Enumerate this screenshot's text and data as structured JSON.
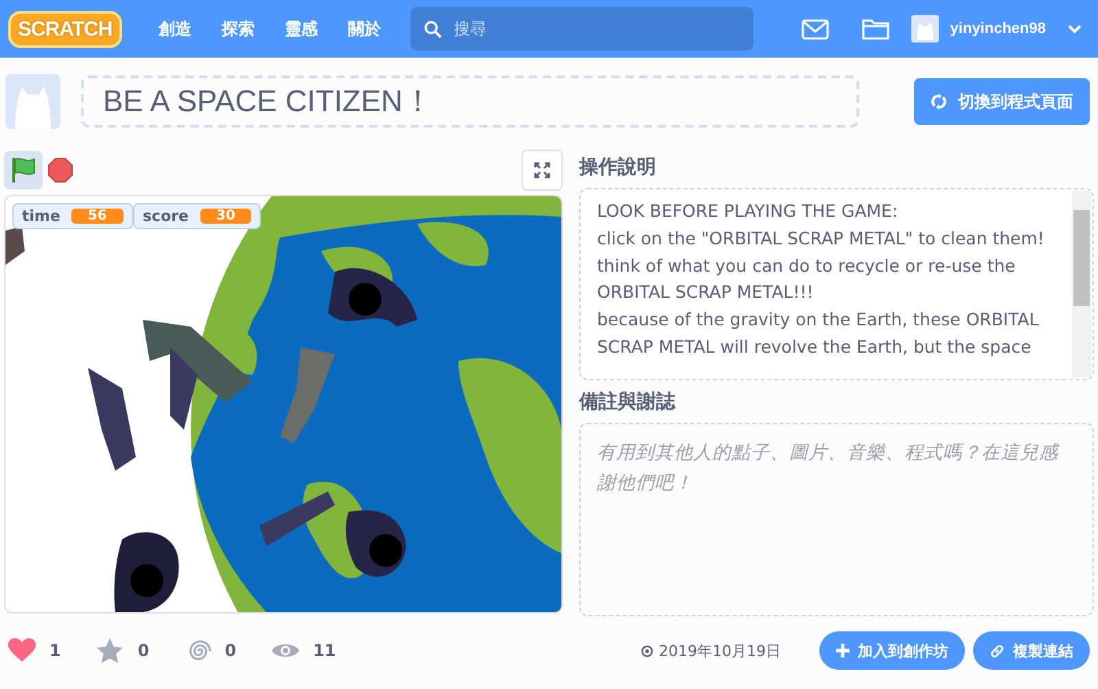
{
  "navbar": {
    "logo": "SCRATCH",
    "links": [
      "創造",
      "探索",
      "靈感",
      "關於"
    ],
    "search": {
      "placeholder": "搜尋"
    },
    "username": "yinyinchen98"
  },
  "project": {
    "title": "BE A SPACE CITIZEN！",
    "see_inside_button": "切換到程式頁面"
  },
  "stage": {
    "monitors": [
      {
        "label": "time",
        "value": "56"
      },
      {
        "label": "score",
        "value": "30"
      }
    ]
  },
  "instructions": {
    "heading": "操作說明",
    "text": "LOOK BEFORE PLAYING THE GAME:\nclick on the \"ORBITAL SCRAP METAL\" to clean them!\nthink of what you can do to recycle or re-use the ORBITAL SCRAP METAL!!!\nbecause of the gravity on the Earth, these ORBITAL SCRAP METAL will revolve the Earth, but the space"
  },
  "notes": {
    "heading": "備註與謝誌",
    "placeholder": "有用到其他人的點子、圖片、音樂、程式嗎？在這兒感謝他們吧！"
  },
  "stats": [
    {
      "kind": "love",
      "count": "1",
      "on": true
    },
    {
      "kind": "favorite",
      "count": "0",
      "on": false
    },
    {
      "kind": "remix",
      "count": "0",
      "on": false
    },
    {
      "kind": "views",
      "count": "11",
      "on": false
    }
  ],
  "date": "2019年10月19日",
  "buttons": [
    {
      "kind": "studio",
      "label": "加入到創作坊"
    },
    {
      "kind": "link",
      "label": "複製連結"
    }
  ]
}
